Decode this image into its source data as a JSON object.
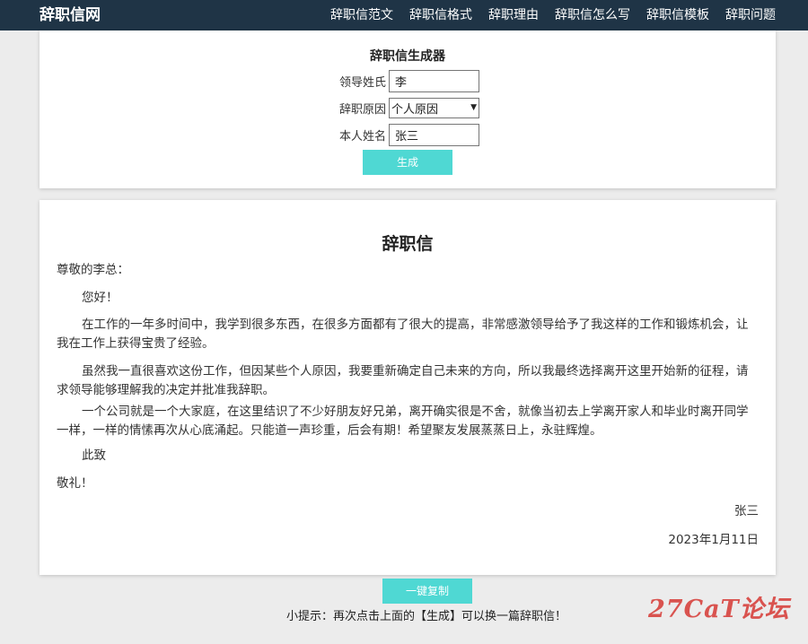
{
  "header": {
    "logo": "辞职信网",
    "nav": [
      "辞职信范文",
      "辞职信格式",
      "辞职理由",
      "辞职信怎么写",
      "辞职信模板",
      "辞职问题"
    ]
  },
  "generator": {
    "title": "辞职信生成器",
    "leader_label": "领导姓氏",
    "leader_value": "李",
    "reason_label": "辞职原因",
    "reason_value": "个人原因",
    "name_label": "本人姓名",
    "name_value": "张三",
    "generate_label": "生成"
  },
  "letter": {
    "title": "辞职信",
    "salutation": "尊敬的李总：",
    "greeting": "您好！",
    "p1": "在工作的一年多时间中，我学到很多东西，在很多方面都有了很大的提高，非常感激领导给予了我这样的工作和锻炼机会，让我在工作上获得宝贵了经验。",
    "p2": "虽然我一直很喜欢这份工作，但因某些个人原因，我要重新确定自己未来的方向，所以我最终选择离开这里开始新的征程，请求领导能够理解我的决定并批准我辞职。",
    "p3": "一个公司就是一个大家庭，在这里结识了不少好朋友好兄弟，离开确实很是不舍，就像当初去上学离开家人和毕业时离开同学一样，一样的情愫再次从心底涌起。只能道一声珍重，后会有期！希望聚友发展蒸蒸日上，永驻辉煌。",
    "closing": "此致",
    "regards": "敬礼！",
    "signature": "张三",
    "date": "2023年1月11日"
  },
  "copy_label": "一键复制",
  "tip": "小提示：再次点击上面的【生成】可以换一篇辞职信！",
  "watermark": "27CaT论坛",
  "colors": {
    "header_bg": "#1f3446",
    "button": "#4fd8d3",
    "watermark": "#d9534f"
  }
}
